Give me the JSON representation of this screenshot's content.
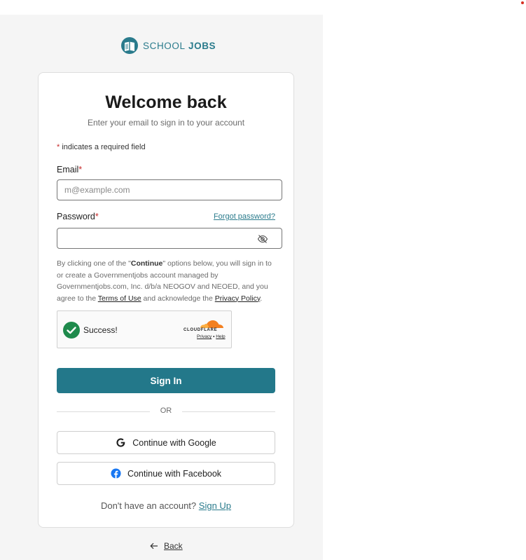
{
  "brand": {
    "name_part1": "SCHOOL",
    "name_part2": "JOBS",
    "color": "#2a7b8c",
    "logo_icon": "school-jobs-book-icon"
  },
  "header": {
    "title": "Welcome back",
    "subtitle": "Enter your email to sign in to your account"
  },
  "form": {
    "required_star": "*",
    "required_note": "indicates a required field",
    "email": {
      "label": "Email",
      "placeholder": "m@example.com",
      "value": ""
    },
    "password": {
      "label": "Password",
      "value": "",
      "toggle_icon": "eye-off-icon",
      "forgot_link": "Forgot password?"
    },
    "disclaimer": {
      "part1": "By clicking one of the \"",
      "continue_word": "Continue",
      "part2": "\" options below, you will sign in to or create a Governmentjobs account managed by Governmentjobs.com, Inc. d/b/a NEOGOV and NEOED, and you agree to the ",
      "terms_link": "Terms of Use",
      "part3": " and acknowledge the ",
      "privacy_link": "Privacy Policy",
      "part4": "."
    },
    "captcha": {
      "status": "Success!",
      "provider": "CLOUDFLARE",
      "privacy_link": "Privacy",
      "separator": "•",
      "help_link": "Help",
      "status_icon": "check-circle-icon"
    },
    "submit_label": "Sign In",
    "submit_color": "#23788a",
    "divider_text": "OR",
    "google_label": "Continue with Google",
    "facebook_label": "Continue with Facebook",
    "signup_prompt": "Don't have an account?",
    "signup_link": "Sign Up"
  },
  "footer": {
    "back_label": "Back",
    "back_icon": "arrow-left-icon"
  }
}
